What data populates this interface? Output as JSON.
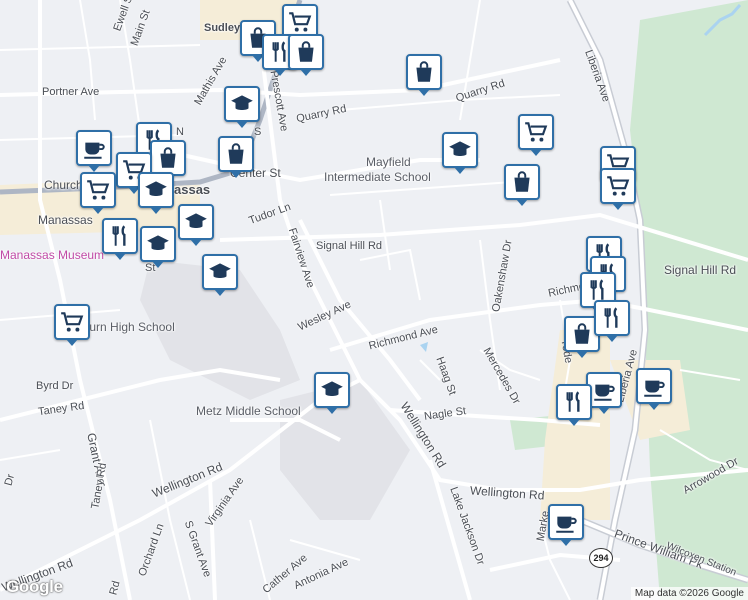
{
  "streets": {
    "main_st": "Main St",
    "ewell_st": "Ewell St",
    "sudley": "Sudley",
    "mathis_ave": "Mathis Ave",
    "portner_ave": "Portner Ave",
    "prescott_ave": "Prescott Ave",
    "quarry_rd_1": "Quarry Rd",
    "quarry_rd_2": "Quarry Rd",
    "center_st": "Center St",
    "church": "Church",
    "manassas": "Manassas",
    "tudor_ln": "Tudor Ln",
    "fairview_ave": "Fairview Ave",
    "signal_hill_rd_1": "Signal Hill Rd",
    "signal_hill_rd_2": "Signal Hill Rd",
    "wesley_ave": "Wesley Ave",
    "richmond_ave_1": "Richmond Ave",
    "richmond_ave_2": "Richmo",
    "oakenshaw_dr": "Oakenshaw Dr",
    "haag_st": "Haag St",
    "mercedes_dr": "Mercedes Dr",
    "yoder": "Yode",
    "liberia_ave_1": "Liberia Ave",
    "liberia_ave_2": "Liberia Ave",
    "manassas_2": "Manassas",
    "byrd_dr": "Byrd Dr",
    "taney_rd": "Taney Rd",
    "grant_ave": "Grant Ave",
    "taney_rd_2": "Taney Rd",
    "wellington_rd_1": "Wellington Rd",
    "wellington_rd_2": "Wellington Rd",
    "wellington_rd_3": "Wellington Rd",
    "wellington_rd_4": "Wellington Rd",
    "nagle_st": "Nagle St",
    "virginia_ave": "Virginia Ave",
    "s_grant_ave": "S Grant Ave",
    "orchard_ln": "Orchard Ln",
    "lake_jackson_dr": "Lake Jackson Dr",
    "arrowood_dr": "Arrowood Dr",
    "marke": "Marke",
    "prince_william_pkwy": "Prince William Pk",
    "wilcoxen": "Wilcoxen Station",
    "cather_ave": "Cather Ave",
    "antonia_ave": "Antonia Ave",
    "rd_left": "Rd",
    "dr_left": "Dr",
    "n_label": "N",
    "st_label": "St",
    "s_label": "S"
  },
  "pois": {
    "mayfield": "Mayfield",
    "intermediate_school": "Intermediate School",
    "manassas_museum": "Manassas Museum",
    "osbourn": "sbourn High School",
    "metz": "Metz Middle School"
  },
  "route_shield": "294",
  "logo": "Google",
  "attribution": "Map data ©2026 Google",
  "colors": {
    "background": "#eef0f4",
    "road": "#ffffff",
    "major_road": "#c8ccd4",
    "highway": "#aeb6c4",
    "park": "#cfe8d2",
    "school_area": "#e2e3e8",
    "commercial": "#f5edd8",
    "water": "#aad3f0",
    "pin_border": "#2f6fa7",
    "pin_icon": "#1f3a5a"
  },
  "markers": [
    {
      "type": "shopping-cart"
    },
    {
      "type": "shopping-bag"
    },
    {
      "type": "restaurant"
    },
    {
      "type": "shopping-bag"
    },
    {
      "type": "shopping-bag"
    },
    {
      "type": "school"
    },
    {
      "type": "shopping-bag"
    },
    {
      "type": "coffee"
    },
    {
      "type": "restaurant"
    },
    {
      "type": "shopping-bag"
    },
    {
      "type": "shopping-cart"
    },
    {
      "type": "shopping-cart"
    },
    {
      "type": "school"
    },
    {
      "type": "school"
    },
    {
      "type": "restaurant"
    },
    {
      "type": "school"
    },
    {
      "type": "school"
    },
    {
      "type": "shopping-cart"
    },
    {
      "type": "shopping-cart"
    },
    {
      "type": "school"
    },
    {
      "type": "shopping-bag"
    },
    {
      "type": "shopping-cart"
    },
    {
      "type": "shopping-cart"
    },
    {
      "type": "restaurant"
    },
    {
      "type": "restaurant"
    },
    {
      "type": "restaurant"
    },
    {
      "type": "shopping-bag"
    },
    {
      "type": "restaurant"
    },
    {
      "type": "coffee"
    },
    {
      "type": "coffee"
    },
    {
      "type": "restaurant"
    },
    {
      "type": "school"
    },
    {
      "type": "coffee"
    }
  ]
}
